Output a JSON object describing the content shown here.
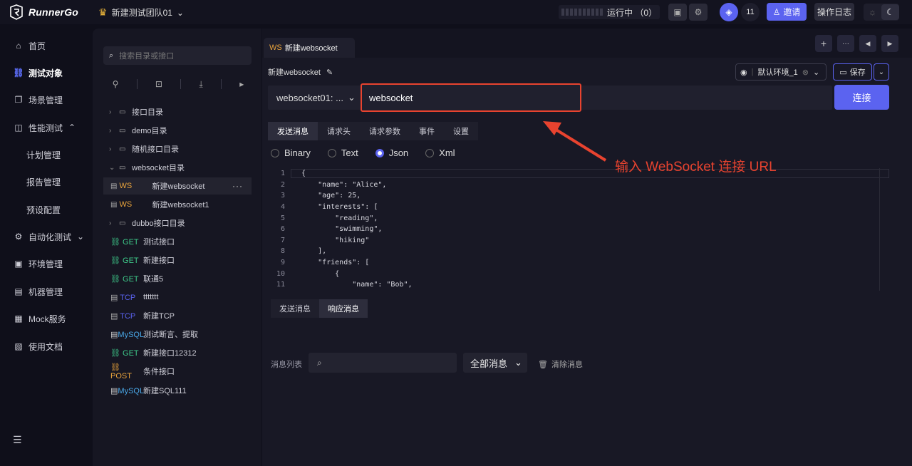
{
  "header": {
    "app_name": "RunnerGo",
    "team_name": "新建测试团队01",
    "run_status": "运行中 （0）",
    "member_count": "11",
    "invite_label": "邀请",
    "log_label": "操作日志"
  },
  "sidenav": {
    "items": [
      {
        "label": "首页",
        "icon": "home-icon"
      },
      {
        "label": "测试对象",
        "icon": "link-icon"
      },
      {
        "label": "场景管理",
        "icon": "scene-icon"
      },
      {
        "label": "性能测试",
        "icon": "chart-icon"
      },
      {
        "label": "计划管理"
      },
      {
        "label": "报告管理"
      },
      {
        "label": "预设配置"
      },
      {
        "label": "自动化测试",
        "icon": "automation-icon"
      },
      {
        "label": "环境管理",
        "icon": "env-icon"
      },
      {
        "label": "机器管理",
        "icon": "machine-icon"
      },
      {
        "label": "Mock服务",
        "icon": "mock-icon"
      },
      {
        "label": "使用文档",
        "icon": "doc-icon"
      }
    ]
  },
  "tree": {
    "search_placeholder": "搜索目录或接口",
    "folders": [
      {
        "label": "接口目录"
      },
      {
        "label": "demo目录"
      },
      {
        "label": "随机接口目录"
      },
      {
        "label": "websocket目录"
      }
    ],
    "ws_items": [
      {
        "method": "WS",
        "label": "新建websocket"
      },
      {
        "method": "WS",
        "label": "新建websocket1"
      }
    ],
    "dubbo_folder": "dubbo接口目录",
    "apis": [
      {
        "method": "GET",
        "label": "测试接口"
      },
      {
        "method": "GET",
        "label": "新建接口"
      },
      {
        "method": "GET",
        "label": "联通5"
      },
      {
        "method": "TCP",
        "label": "ttttttt"
      },
      {
        "method": "TCP",
        "label": "新建TCP"
      },
      {
        "method": "MySQL",
        "label": "测试断言、提取"
      },
      {
        "method": "GET",
        "label": "新建接口12312"
      },
      {
        "method": "POST",
        "label": "条件接口"
      },
      {
        "method": "MySQL",
        "label": "新建SQL111"
      }
    ]
  },
  "editor": {
    "tab_tag": "WS",
    "tab_label": "新建websocket",
    "title": "新建websocket",
    "env_label": "默认环境_1",
    "save_label": "保存",
    "protocol": "websocket01: ...",
    "url": "websocket",
    "connect_label": "连接",
    "req_tabs": [
      "发送消息",
      "请求头",
      "请求参数",
      "事件",
      "设置"
    ],
    "body_types": [
      "Binary",
      "Text",
      "Json",
      "Xml"
    ],
    "selected_body_type": "Json",
    "code_lines": [
      "{",
      "    \"name\": \"Alice\",",
      "    \"age\": 25,",
      "    \"interests\": [",
      "        \"reading\",",
      "        \"swimming\",",
      "        \"hiking\"",
      "    ],",
      "    \"friends\": [",
      "        {",
      "            \"name\": \"Bob\","
    ],
    "resp_tabs": [
      "发送消息",
      "响应消息"
    ],
    "msg_list_label": "消息列表",
    "msg_filter": "全部消息",
    "clear_label": "清除消息"
  },
  "annotation": "输入 WebSocket 连接 URL",
  "colors": {
    "accent": "#5b63f0",
    "annotation": "#e8432f",
    "get": "#3ec98a",
    "post": "#e8a33c",
    "ws": "#e8a33c",
    "tcp": "#5b63f0",
    "mysql": "#4aa8e8"
  }
}
